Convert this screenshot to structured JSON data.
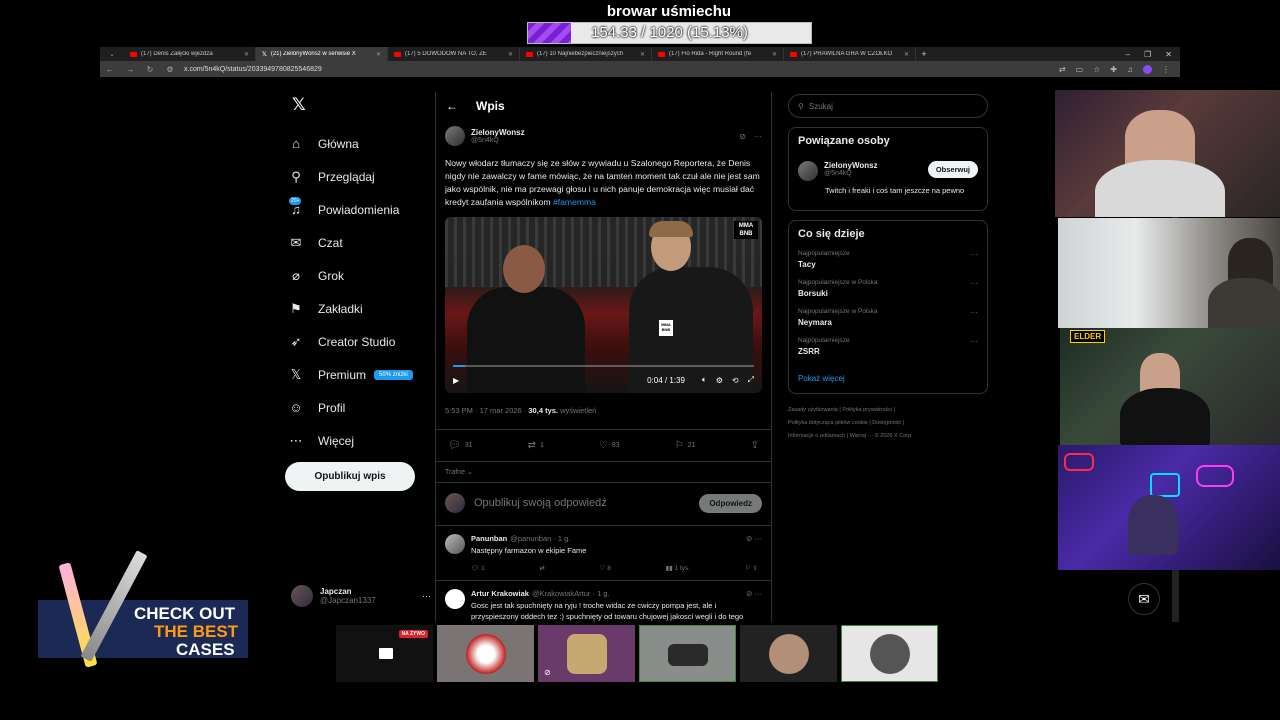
{
  "overlay": {
    "goal_title": "browar uśmiechu",
    "goal_progress": "154.33 / 1020 (15.13%)",
    "goal_fraction": 0.1513
  },
  "browser": {
    "tabs": [
      {
        "label": "(17) Denis Załęcki wjeżdża",
        "icon": "youtube-icon",
        "active": false
      },
      {
        "label": "(21) ZielonyWonsz w serwisie X",
        "icon": "x-icon",
        "active": true
      },
      {
        "label": "(17) 5 DOWODÓW NA TO, ŻE",
        "icon": "youtube-icon",
        "active": false
      },
      {
        "label": "(17) 10 Najniebezpieczniejszych",
        "icon": "youtube-icon",
        "active": false
      },
      {
        "label": "(17) Flo Rida - Right Round (fe",
        "icon": "youtube-icon",
        "active": false
      },
      {
        "label": "(17) PRAWILNA GRA W CZÓŁKO",
        "icon": "youtube-icon",
        "active": false
      }
    ],
    "url": "x.com/5n4kQ/status/2033949780825546829"
  },
  "nav": {
    "items": [
      {
        "label": "Główna",
        "icon": "home-icon",
        "glyph": "⌂"
      },
      {
        "label": "Przeglądaj",
        "icon": "search-icon",
        "glyph": "⚲"
      },
      {
        "label": "Powiadomienia",
        "icon": "bell-icon",
        "glyph": "♫"
      },
      {
        "label": "Czat",
        "icon": "mail-icon",
        "glyph": "✉"
      },
      {
        "label": "Grok",
        "icon": "grok-icon",
        "glyph": "⌀"
      },
      {
        "label": "Zakładki",
        "icon": "bookmark-icon",
        "glyph": "⚑"
      },
      {
        "label": "Creator Studio",
        "icon": "rocket-icon",
        "glyph": "➶"
      },
      {
        "label": "Premium",
        "icon": "x-icon",
        "glyph": "𝕏"
      },
      {
        "label": "Profil",
        "icon": "person-icon",
        "glyph": "☺"
      },
      {
        "label": "Więcej",
        "icon": "more-circle-icon",
        "glyph": "⋯"
      }
    ],
    "notif_badge": "20+",
    "premium_badge": "50% zniżki",
    "post_button": "Opublikuj wpis",
    "account_name": "Japczan",
    "account_handle": "@Japczan1337"
  },
  "post": {
    "header": "Wpis",
    "author_name": "ZielonyWonsz",
    "author_handle": "@5n4kQ",
    "text": "Nowy włodarz tłumaczy się ze słów z wywiadu u Szalonego Reportera, że Denis nigdy nie zawalczy w fame mówiąc, że na tamten moment tak czuł ale nie jest sam jako wspólnik, nie ma przewagi głosu i u nich panuje demokracja więc musiał dać kredyt zaufania wspólnikom",
    "hashtag": "#famemma",
    "video_logo": "MMA BNB",
    "video_time": "0:04 / 1:39",
    "video_progress": 0.04,
    "timestamp": "5:53 PM · 17 mar 2026 ·",
    "views_count": "30,4 tys.",
    "views_label": "wyświetleń",
    "replies": "31",
    "reposts": "1",
    "likes": "83",
    "bookmarks": "21",
    "sort_label": "Trafne",
    "reply_placeholder": "Opublikuj swoją odpowiedź",
    "reply_button": "Odpowiedz"
  },
  "replies": [
    {
      "name": "Panunban",
      "handle": "@panunban · 1 g.",
      "text": "Następny farmazon w ekipie Fame",
      "replies": "1",
      "reposts": "",
      "likes": "8",
      "views": "1 tys."
    },
    {
      "name": "Artur Krakowiak",
      "handle": "@KrakowiakArtur · 1 g.",
      "text": "Gosc jest tak spuchnięty na ryju ! troche widac ze cwiczy pompa jest, ale i przyspieszony oddech tez :) spuchnięty od towaru chujowej jakosci wegli i do tego farmazon ba odzew podejdziem odzewemy ...za ale to ale zostaroly"
    }
  ],
  "sidebar": {
    "search_placeholder": "Szukaj",
    "related_title": "Powiązane osoby",
    "related_name": "ZielonyWonsz",
    "related_handle": "@5n4kQ",
    "follow_button": "Obserwuj",
    "related_bio": "Twitch i freaki i coś tam jeszcze na pewno",
    "trending_title": "Co się dzieje",
    "trends": [
      {
        "category": "Najpopularniejsze",
        "name": "Tacy"
      },
      {
        "category": "Najpopularniejsze w Polska",
        "name": "Borsuki"
      },
      {
        "category": "Najpopularniejsze w Polska",
        "name": "Neymara"
      },
      {
        "category": "Najpopularniejsze",
        "name": "ZSRR"
      }
    ],
    "show_more": "Pokaż więcej",
    "footer_line1": "Zasady użytkowania  |  Polityka prywatności  |",
    "footer_line2": "Polityka dotycząca plików cookie  |  Dostępność  |",
    "footer_line3": "Informacje o reklamach  |  Więcej ···  © 2026 X Corp."
  },
  "cams": {
    "elder_label": "ELDER"
  },
  "promo": {
    "line1": "CHECK OUT",
    "line2": "THE BEST",
    "line3": "CASES"
  },
  "viewers": {
    "live_badge": "NA ŻYWO"
  }
}
